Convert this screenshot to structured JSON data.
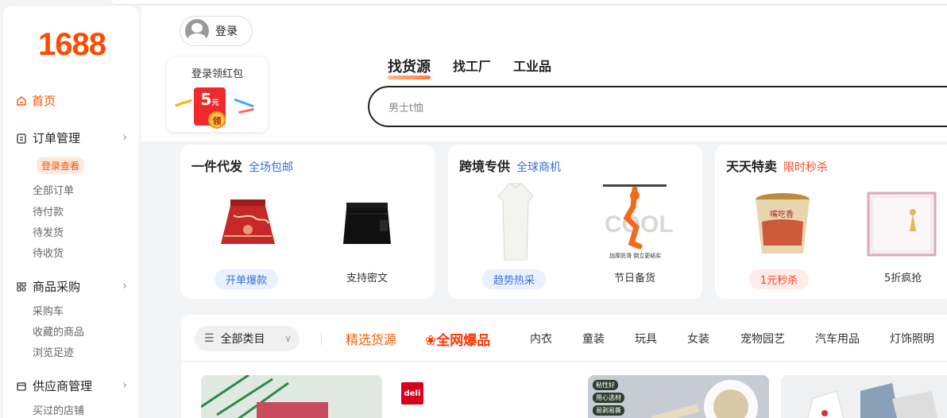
{
  "sidebar": {
    "logo": "1688",
    "home": "首页",
    "orders": {
      "title": "订单管理",
      "login_badge": "登录查看",
      "items": [
        "全部订单",
        "待付款",
        "待发货",
        "待收货"
      ]
    },
    "purchase": {
      "title": "商品采购",
      "items": [
        "采购车",
        "收藏的商品",
        "浏览足迹"
      ]
    },
    "supplier": {
      "title": "供应商管理",
      "items": [
        "买过的店铺"
      ]
    }
  },
  "header": {
    "login_label": "登录",
    "redpacket": {
      "title": "登录领红包",
      "amount": "5",
      "unit": "元",
      "coin": "领"
    },
    "tabs": [
      "找货源",
      "找工厂",
      "工业品"
    ],
    "search_placeholder": "男士t恤"
  },
  "promos": [
    {
      "title": "一件代发",
      "subtitle": "全场包邮",
      "subtitle_color": "#3a6fd8",
      "captions": [
        "开单爆款",
        "支持密文"
      ]
    },
    {
      "title": "跨境专供",
      "subtitle": "全球商机",
      "subtitle_color": "#3a6fd8",
      "captions": [
        "趋势热采",
        "节日备货"
      ],
      "product_text": [
        "COOL",
        "加厚",
        "防滑",
        "倒立",
        "更结实",
        "耐用的"
      ]
    },
    {
      "title": "天天特卖",
      "subtitle": "限时秒杀",
      "subtitle_color": "#ff4a2a",
      "captions": [
        "1元秒杀",
        "5折疯抢"
      ],
      "product_text": "嘴吃香"
    }
  ],
  "category_bar": {
    "all": "全部类目",
    "featured": "精选货源",
    "hot": "全网爆品",
    "items": [
      "内衣",
      "童装",
      "玩具",
      "女装",
      "宠物园艺",
      "汽车用品",
      "灯饰照明"
    ]
  },
  "products": {
    "brand": "deli",
    "tags": [
      "粘性好",
      "用心选材",
      "易剥易撕"
    ]
  },
  "colors": {
    "brand": "#ff5000",
    "blue": "#3a6fd8"
  }
}
